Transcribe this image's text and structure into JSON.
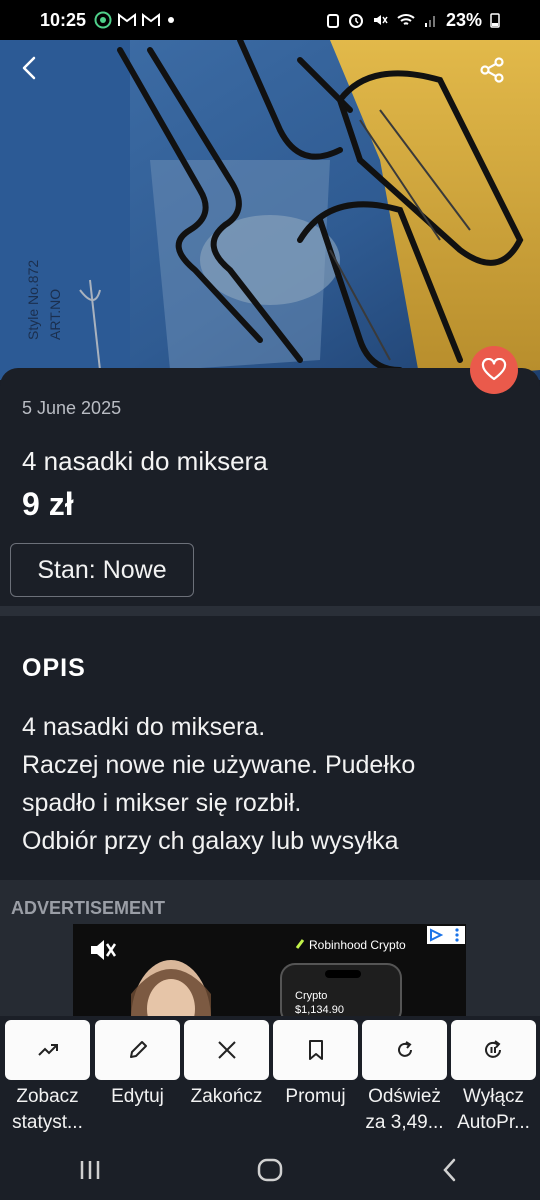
{
  "status_bar": {
    "time": "10:25",
    "left_icons": [
      "whatsapp-icon",
      "gmail-icon",
      "gmail-icon",
      "dot-icon"
    ],
    "right_icons": [
      "alarm-icon",
      "clock-icon",
      "mute-icon",
      "wifi-icon",
      "signal-icon"
    ],
    "battery": "23%"
  },
  "listing": {
    "date": "5 June 2025",
    "title": "4 nasadki do miksera",
    "price": "9 zł",
    "condition": "Stan: Nowe"
  },
  "description": {
    "heading": "OPIS",
    "lines": [
      "4 nasadki do miksera.",
      "Raczej nowe nie używane. Pudełko",
      "spadło i mikser się rozbił.",
      "Odbiór przy ch galaxy lub wysyłka"
    ]
  },
  "ad": {
    "label": "ADVERTISEMENT",
    "brand": "Robinhood Crypto",
    "phone_title": "Crypto",
    "phone_value": "$1,134.90"
  },
  "actions": [
    {
      "label1": "Zobacz",
      "label2": "statyst...",
      "icon": "trending-up-icon"
    },
    {
      "label1": "Edytuj",
      "label2": "",
      "icon": "pencil-icon"
    },
    {
      "label1": "Zakończ",
      "label2": "",
      "icon": "close-icon"
    },
    {
      "label1": "Promuj",
      "label2": "",
      "icon": "bookmark-icon"
    },
    {
      "label1": "Odśwież",
      "label2": "za 3,49...",
      "icon": "refresh-icon"
    },
    {
      "label1": "Wyłącz",
      "label2": "AutoPr...",
      "icon": "pause-refresh-icon"
    }
  ],
  "colors": {
    "background": "#1b1f27",
    "favorite": "#ea5a4b",
    "action_button": "#fbfbfb"
  }
}
